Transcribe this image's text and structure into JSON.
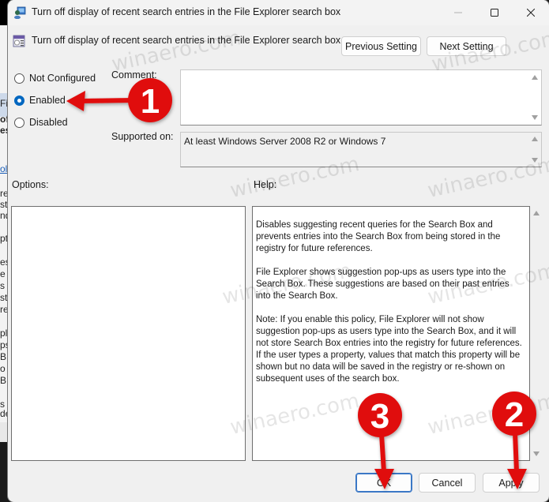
{
  "background_window": {
    "fragments": [
      "Fil",
      "of",
      "es i",
      "oli",
      "re",
      "st '",
      "nd",
      "pt",
      "es",
      "e S",
      "s i",
      "st",
      "re",
      "pl",
      "ps",
      "B",
      "o",
      "B",
      "s",
      "de"
    ]
  },
  "dialog": {
    "title": "Turn off display of recent search entries in the File Explorer search box",
    "window_controls": {
      "minimize": "minimize",
      "maximize": "maximize",
      "close": "close"
    },
    "policy_title": "Turn off display of recent search entries in the File Explorer search box",
    "previous_setting_label": "Previous Setting",
    "next_setting_label": "Next Setting",
    "state_options": [
      {
        "label": "Not Configured",
        "checked": false
      },
      {
        "label": "Enabled",
        "checked": true
      },
      {
        "label": "Disabled",
        "checked": false
      }
    ],
    "comment_label": "Comment:",
    "comment_value": "",
    "supported_on_label": "Supported on:",
    "supported_on_value": "At least Windows Server 2008 R2 or Windows 7",
    "options_label": "Options:",
    "help_label": "Help:",
    "help_paragraphs": [
      "Disables suggesting recent queries for the Search Box and prevents entries into the Search Box from being stored in the registry for future references.",
      "File Explorer shows suggestion pop-ups as users type into the Search Box.  These suggestions are based on their past entries into the Search Box.",
      "Note: If you enable this policy, File Explorer will not show suggestion pop-ups as users type into the Search Box, and it will not store Search Box entries into the registry for future references.  If the user types a property, values that match this property will be shown but no data will be saved in the registry or re-shown on subsequent uses of the search box."
    ],
    "ok_label": "OK",
    "cancel_label": "Cancel",
    "apply_label": "Apply"
  },
  "annotations": {
    "color": "#e00d0d",
    "steps": [
      "1",
      "2",
      "3"
    ]
  },
  "watermark": "winaero.com"
}
